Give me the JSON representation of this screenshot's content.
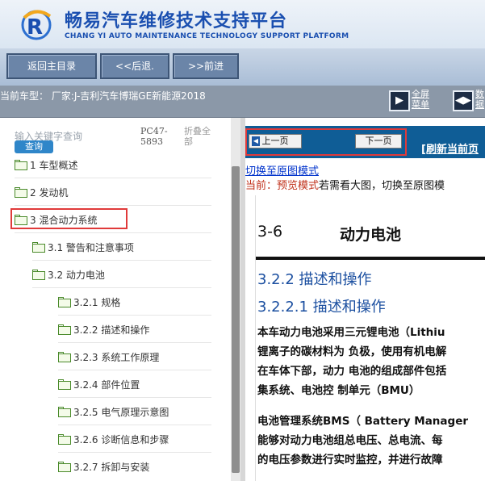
{
  "header": {
    "title": "畅易汽车维修技术支持平台",
    "subtitle": "CHANG YI AUTO MAINTENANCE TECHNOLOGY SUPPORT PLATFORM",
    "brand_color": "#1a4fb0"
  },
  "toolbar": {
    "home_label": "返回主目录",
    "back_label": "<<后退.",
    "forward_label": ">>前进"
  },
  "infobar": {
    "model_label": "当前车型：  厂家:J-吉利汽车博瑞GE新能源2018",
    "fullmenu_label": "全屏菜单",
    "dual_label": "数据"
  },
  "search": {
    "placeholder": "输入关键字查询",
    "button_label": "查询",
    "pc_code": "PC47-5893",
    "collapse_label": "折叠全部"
  },
  "tree": {
    "items": [
      {
        "label": "1 车型概述"
      },
      {
        "label": "2 发动机"
      },
      {
        "label": "3 混合动力系统"
      },
      {
        "label": "3.1 警告和注意事项"
      },
      {
        "label": "3.2 动力电池"
      },
      {
        "label": "3.2.1 规格"
      },
      {
        "label": "3.2.2 描述和操作"
      },
      {
        "label": "3.2.3 系统工作原理"
      },
      {
        "label": "3.2.4 部件位置"
      },
      {
        "label": "3.2.5 电气原理示意图"
      },
      {
        "label": "3.2.6 诊断信息和步骤"
      },
      {
        "label": "3.2.7 拆卸与安装"
      }
    ],
    "selected": "3 混合动力系统"
  },
  "viewer": {
    "prev_label": "上一页",
    "next_label": "下一页",
    "refresh_label": "[刷新当前页",
    "switch_mode": "切换至原图模式",
    "mode_prefix": "当前：",
    "mode_name": "预览模式",
    "mode_hint": "若需看大图，切换至原图模"
  },
  "document": {
    "section_number": "3-6",
    "section_title": "动力电池",
    "heading1": "3.2.2 描述和操作",
    "heading2": "3.2.2.1 描述和操作",
    "paragraph1": [
      "本车动力电池采用三元锂电池（Lithiu",
      "锂离子的碳材料为 负极，使用有机电解",
      "在车体下部，动力 电池的组成部件包括",
      "集系统、电池控 制单元（BMU）"
    ],
    "paragraph2": [
      "电池管理系统BMS（ Battery Manager",
      "能够对动力电池组总电压、总电流、每",
      "的电压参数进行实时监控，并进行故障"
    ]
  },
  "colors": {
    "nav_strip": "#0f5d96",
    "highlight": "#e03a3a",
    "heading": "#1b4fa0"
  }
}
